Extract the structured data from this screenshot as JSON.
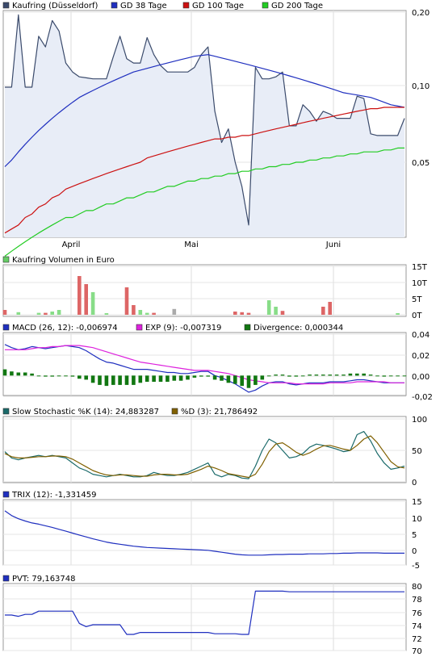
{
  "months": [
    "April",
    "Mai",
    "Juni"
  ],
  "panels": {
    "price": {
      "legend": [
        {
          "label": "Kaufring (Düsseldorf)",
          "color": "#3a4a6b"
        },
        {
          "label": "GD 38 Tage",
          "color": "#1f2fbf"
        },
        {
          "label": "GD 100 Tage",
          "color": "#cc1111"
        },
        {
          "label": "GD 200 Tage",
          "color": "#22cc22"
        }
      ],
      "ticks": [
        "0,20",
        "0,10",
        "0,05"
      ]
    },
    "volume": {
      "legend": [
        {
          "label": "Kaufring Volumen in Euro",
          "color": "#66cc66"
        }
      ],
      "ticks": [
        "15T",
        "10T",
        "5T",
        "0T"
      ]
    },
    "macd": {
      "legend": [
        {
          "label": "MACD (26, 12): -0,006974",
          "color": "#1f2fbf"
        },
        {
          "label": "EXP (9): -0,007319",
          "color": "#dd22dd"
        },
        {
          "label": "Divergence: 0,000344",
          "color": "#117711"
        }
      ],
      "ticks": [
        "0,04",
        "0,02",
        "0,00",
        "-0,02"
      ]
    },
    "stoch": {
      "legend": [
        {
          "label": "Slow Stochastic %K (14): 24,883287",
          "color": "#1a6a6a"
        },
        {
          "label": "%D (3): 21,786492",
          "color": "#806000"
        }
      ],
      "ticks": [
        "100",
        "50",
        "0"
      ]
    },
    "trix": {
      "legend": [
        {
          "label": "TRIX (12): -1,331459",
          "color": "#1f2fbf"
        }
      ],
      "ticks": [
        "15",
        "10",
        "5",
        "0",
        "-5"
      ]
    },
    "pvt": {
      "legend": [
        {
          "label": "PVT: 79,163748",
          "color": "#1f2fbf"
        }
      ],
      "ticks": [
        "80",
        "78",
        "76",
        "74",
        "72",
        "70"
      ]
    }
  },
  "chart_data": [
    {
      "type": "line",
      "ylim": [
        0.02,
        0.2
      ],
      "log_scale": true,
      "n_points": 60,
      "series": [
        {
          "name": "Kaufring (Düsseldorf)",
          "color": "#3a4a6b",
          "fill": "#e8edf7",
          "values": [
            0.1,
            0.1,
            0.195,
            0.1,
            0.1,
            0.16,
            0.145,
            0.185,
            0.168,
            0.125,
            0.115,
            0.11,
            0.109,
            0.108,
            0.108,
            0.108,
            0.132,
            0.16,
            0.13,
            0.125,
            0.125,
            0.158,
            0.135,
            0.122,
            0.115,
            0.115,
            0.115,
            0.115,
            0.12,
            0.135,
            0.145,
            0.08,
            0.06,
            0.068,
            0.05,
            0.04,
            0.028,
            0.12,
            0.108,
            0.108,
            0.11,
            0.115,
            0.07,
            0.07,
            0.085,
            0.08,
            0.073,
            0.08,
            0.078,
            0.075,
            0.075,
            0.075,
            0.092,
            0.09,
            0.065,
            0.064,
            0.064,
            0.064,
            0.064,
            0.075
          ]
        },
        {
          "name": "GD 38 Tage",
          "color": "#1f2fbf",
          "values": [
            0.048,
            0.051,
            0.055,
            0.059,
            0.063,
            0.067,
            0.071,
            0.075,
            0.079,
            0.083,
            0.087,
            0.091,
            0.094,
            0.097,
            0.1,
            0.103,
            0.106,
            0.109,
            0.112,
            0.115,
            0.117,
            0.119,
            0.121,
            0.123,
            0.125,
            0.127,
            0.129,
            0.131,
            0.133,
            0.134,
            0.135,
            0.133,
            0.131,
            0.129,
            0.127,
            0.125,
            0.123,
            0.121,
            0.119,
            0.117,
            0.115,
            0.113,
            0.111,
            0.109,
            0.107,
            0.105,
            0.103,
            0.101,
            0.099,
            0.097,
            0.095,
            0.094,
            0.093,
            0.092,
            0.091,
            0.089,
            0.087,
            0.085,
            0.084,
            0.083
          ]
        },
        {
          "name": "GD 100 Tage",
          "color": "#cc1111",
          "values": [
            0.026,
            0.027,
            0.028,
            0.03,
            0.031,
            0.033,
            0.034,
            0.036,
            0.037,
            0.039,
            0.04,
            0.041,
            0.042,
            0.043,
            0.044,
            0.045,
            0.046,
            0.047,
            0.048,
            0.049,
            0.05,
            0.052,
            0.053,
            0.054,
            0.055,
            0.056,
            0.057,
            0.058,
            0.059,
            0.06,
            0.061,
            0.062,
            0.062,
            0.063,
            0.063,
            0.064,
            0.064,
            0.065,
            0.066,
            0.067,
            0.068,
            0.069,
            0.07,
            0.071,
            0.072,
            0.073,
            0.074,
            0.075,
            0.076,
            0.077,
            0.078,
            0.079,
            0.08,
            0.081,
            0.082,
            0.082,
            0.083,
            0.083,
            0.083,
            0.083
          ]
        },
        {
          "name": "GD 200 Tage",
          "color": "#22cc22",
          "values": [
            0.021,
            0.022,
            0.023,
            0.024,
            0.025,
            0.026,
            0.027,
            0.028,
            0.029,
            0.03,
            0.03,
            0.031,
            0.032,
            0.032,
            0.033,
            0.034,
            0.034,
            0.035,
            0.036,
            0.036,
            0.037,
            0.038,
            0.038,
            0.039,
            0.04,
            0.04,
            0.041,
            0.042,
            0.042,
            0.043,
            0.043,
            0.044,
            0.044,
            0.045,
            0.045,
            0.046,
            0.046,
            0.047,
            0.047,
            0.048,
            0.048,
            0.049,
            0.049,
            0.05,
            0.05,
            0.051,
            0.051,
            0.052,
            0.052,
            0.053,
            0.053,
            0.054,
            0.054,
            0.055,
            0.055,
            0.055,
            0.056,
            0.056,
            0.057,
            0.057
          ]
        }
      ]
    },
    {
      "type": "bar",
      "ylim": [
        0,
        15000
      ],
      "series": [
        {
          "name": "Kaufring Volumen in Euro",
          "values": [
            1500,
            0,
            800,
            0,
            0,
            600,
            600,
            1000,
            1500,
            0,
            0,
            12000,
            9500,
            7000,
            0,
            500,
            0,
            0,
            8500,
            3000,
            1500,
            600,
            600,
            0,
            0,
            1800,
            0,
            0,
            0,
            0,
            0,
            0,
            0,
            0,
            1000,
            800,
            600,
            0,
            0,
            4500,
            2500,
            1200,
            0,
            0,
            0,
            0,
            0,
            2500,
            4000,
            0,
            0,
            0,
            0,
            0,
            0,
            0,
            0,
            0,
            500,
            0
          ],
          "colors": [
            "#dd6666",
            "#ffffff",
            "#88dd88",
            "#ffffff",
            "#ffffff",
            "#88dd88",
            "#dd6666",
            "#88dd88",
            "#88dd88",
            "#ffffff",
            "#ffffff",
            "#dd6666",
            "#dd6666",
            "#88dd88",
            "#ffffff",
            "#88dd88",
            "#ffffff",
            "#ffffff",
            "#dd6666",
            "#dd6666",
            "#88dd88",
            "#88dd88",
            "#dd6666",
            "#ffffff",
            "#ffffff",
            "#aaaaaa",
            "#ffffff",
            "#ffffff",
            "#ffffff",
            "#ffffff",
            "#ffffff",
            "#ffffff",
            "#ffffff",
            "#ffffff",
            "#dd6666",
            "#dd6666",
            "#dd6666",
            "#ffffff",
            "#ffffff",
            "#88dd88",
            "#88dd88",
            "#dd6666",
            "#ffffff",
            "#ffffff",
            "#ffffff",
            "#ffffff",
            "#ffffff",
            "#dd6666",
            "#dd6666",
            "#ffffff",
            "#ffffff",
            "#ffffff",
            "#ffffff",
            "#ffffff",
            "#ffffff",
            "#ffffff",
            "#ffffff",
            "#ffffff",
            "#88dd88",
            "#ffffff"
          ]
        }
      ]
    },
    {
      "type": "line",
      "ylim": [
        -0.02,
        0.04
      ],
      "series": [
        {
          "name": "MACD (26, 12)",
          "color": "#1f2fbf",
          "values": [
            0.03,
            0.027,
            0.025,
            0.026,
            0.028,
            0.027,
            0.026,
            0.027,
            0.028,
            0.029,
            0.028,
            0.027,
            0.024,
            0.02,
            0.016,
            0.013,
            0.012,
            0.01,
            0.008,
            0.006,
            0.006,
            0.006,
            0.005,
            0.004,
            0.003,
            0.003,
            0.002,
            0.002,
            0.003,
            0.004,
            0.004,
            0.0,
            -0.002,
            -0.005,
            -0.008,
            -0.012,
            -0.016,
            -0.014,
            -0.01,
            -0.007,
            -0.006,
            -0.006,
            -0.008,
            -0.009,
            -0.008,
            -0.007,
            -0.007,
            -0.007,
            -0.006,
            -0.006,
            -0.006,
            -0.005,
            -0.004,
            -0.004,
            -0.005,
            -0.006,
            -0.007,
            -0.007,
            -0.007,
            -0.007
          ]
        },
        {
          "name": "EXP (9)",
          "color": "#dd22dd",
          "values": [
            0.025,
            0.025,
            0.025,
            0.025,
            0.026,
            0.027,
            0.027,
            0.028,
            0.028,
            0.029,
            0.029,
            0.029,
            0.028,
            0.027,
            0.025,
            0.023,
            0.021,
            0.019,
            0.017,
            0.015,
            0.013,
            0.012,
            0.011,
            0.01,
            0.009,
            0.008,
            0.007,
            0.006,
            0.005,
            0.005,
            0.005,
            0.004,
            0.003,
            0.002,
            0.0,
            -0.002,
            -0.004,
            -0.005,
            -0.006,
            -0.007,
            -0.007,
            -0.007,
            -0.007,
            -0.008,
            -0.008,
            -0.008,
            -0.008,
            -0.008,
            -0.007,
            -0.007,
            -0.007,
            -0.007,
            -0.006,
            -0.006,
            -0.006,
            -0.006,
            -0.006,
            -0.007,
            -0.007,
            -0.007
          ]
        },
        {
          "name": "Divergence",
          "color": "#117711",
          "kind": "bar",
          "values": [
            0.006,
            0.004,
            0.003,
            0.003,
            0.002,
            0.0,
            -0.001,
            -0.001,
            0.0,
            0.0,
            -0.001,
            -0.003,
            -0.004,
            -0.007,
            -0.009,
            -0.01,
            -0.009,
            -0.009,
            -0.009,
            -0.009,
            -0.007,
            -0.006,
            -0.006,
            -0.006,
            -0.006,
            -0.005,
            -0.005,
            -0.004,
            -0.002,
            -0.001,
            -0.001,
            -0.004,
            -0.005,
            -0.007,
            -0.008,
            -0.01,
            -0.012,
            -0.009,
            -0.004,
            0.0,
            0.001,
            0.001,
            -0.001,
            -0.001,
            0.0,
            0.001,
            0.001,
            0.001,
            0.001,
            0.001,
            0.001,
            0.002,
            0.002,
            0.002,
            0.001,
            0.0,
            -0.001,
            0.0,
            0.0,
            0.0
          ]
        }
      ]
    },
    {
      "type": "line",
      "ylim": [
        0,
        100
      ],
      "series": [
        {
          "name": "Slow Stochastic %K (14)",
          "color": "#1a6a6a",
          "values": [
            48,
            38,
            35,
            38,
            40,
            42,
            40,
            42,
            40,
            38,
            30,
            22,
            18,
            12,
            10,
            8,
            10,
            12,
            10,
            8,
            8,
            10,
            15,
            12,
            10,
            10,
            12,
            15,
            20,
            25,
            30,
            12,
            8,
            12,
            10,
            6,
            5,
            25,
            50,
            68,
            62,
            50,
            38,
            40,
            45,
            55,
            60,
            58,
            55,
            52,
            48,
            50,
            75,
            80,
            65,
            45,
            30,
            20,
            22,
            25
          ]
        },
        {
          "name": "%D (3)",
          "color": "#806000",
          "values": [
            45,
            40,
            38,
            38,
            39,
            40,
            40,
            41,
            41,
            40,
            36,
            30,
            24,
            18,
            14,
            11,
            10,
            11,
            11,
            10,
            9,
            9,
            11,
            12,
            12,
            11,
            11,
            12,
            16,
            20,
            25,
            22,
            18,
            13,
            11,
            9,
            7,
            12,
            28,
            48,
            60,
            62,
            55,
            47,
            42,
            46,
            52,
            57,
            58,
            55,
            52,
            50,
            58,
            68,
            73,
            62,
            47,
            32,
            24,
            22
          ]
        }
      ]
    },
    {
      "type": "line",
      "ylim": [
        -5,
        15
      ],
      "series": [
        {
          "name": "TRIX (12)",
          "color": "#1f2fbf",
          "values": [
            12,
            10.5,
            9.5,
            8.8,
            8.2,
            7.8,
            7.3,
            6.8,
            6.2,
            5.6,
            5,
            4.4,
            3.8,
            3.2,
            2.7,
            2.2,
            1.8,
            1.5,
            1.2,
            0.9,
            0.7,
            0.5,
            0.4,
            0.3,
            0.2,
            0.1,
            0,
            -0.1,
            -0.2,
            -0.3,
            -0.4,
            -0.7,
            -1,
            -1.3,
            -1.6,
            -1.8,
            -1.9,
            -1.9,
            -1.9,
            -1.8,
            -1.7,
            -1.7,
            -1.6,
            -1.6,
            -1.6,
            -1.5,
            -1.5,
            -1.5,
            -1.4,
            -1.4,
            -1.3,
            -1.3,
            -1.2,
            -1.2,
            -1.2,
            -1.2,
            -1.3,
            -1.3,
            -1.3,
            -1.3
          ]
        }
      ]
    },
    {
      "type": "line",
      "ylim": [
        70,
        80
      ],
      "series": [
        {
          "name": "PVT",
          "color": "#1f2fbf",
          "values": [
            75.5,
            75.5,
            75.3,
            75.6,
            75.6,
            76.1,
            76.1,
            76.1,
            76.1,
            76.1,
            76.1,
            74.2,
            73.7,
            74.0,
            74.0,
            74.0,
            74.0,
            74.0,
            72.5,
            72.5,
            72.8,
            72.8,
            72.8,
            72.8,
            72.8,
            72.8,
            72.8,
            72.8,
            72.8,
            72.8,
            72.8,
            72.6,
            72.6,
            72.6,
            72.6,
            72.5,
            72.5,
            79.2,
            79.2,
            79.2,
            79.2,
            79.2,
            79.1,
            79.1,
            79.1,
            79.1,
            79.1,
            79.1,
            79.1,
            79.1,
            79.1,
            79.1,
            79.1,
            79.1,
            79.1,
            79.1,
            79.1,
            79.1,
            79.1,
            79.1
          ]
        }
      ]
    }
  ]
}
